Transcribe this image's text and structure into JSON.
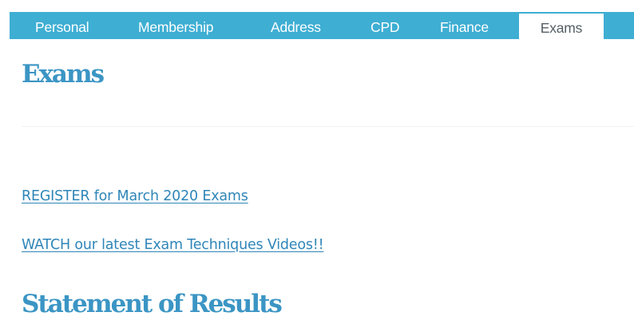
{
  "tabs": [
    {
      "label": "Personal",
      "active": false
    },
    {
      "label": "Membership",
      "active": false
    },
    {
      "label": "Address",
      "active": false
    },
    {
      "label": "CPD",
      "active": false
    },
    {
      "label": "Finance",
      "active": false
    },
    {
      "label": "Exams",
      "active": true
    }
  ],
  "page": {
    "title": "Exams",
    "links": {
      "register": "REGISTER for March 2020 Exams",
      "watch": "WATCH our latest Exam Techniques Videos!!"
    },
    "section_title": "Statement of Results"
  },
  "colors": {
    "tab_bar": "#3eaed3",
    "heading": "#3b95c4",
    "link": "#2f86b8"
  }
}
